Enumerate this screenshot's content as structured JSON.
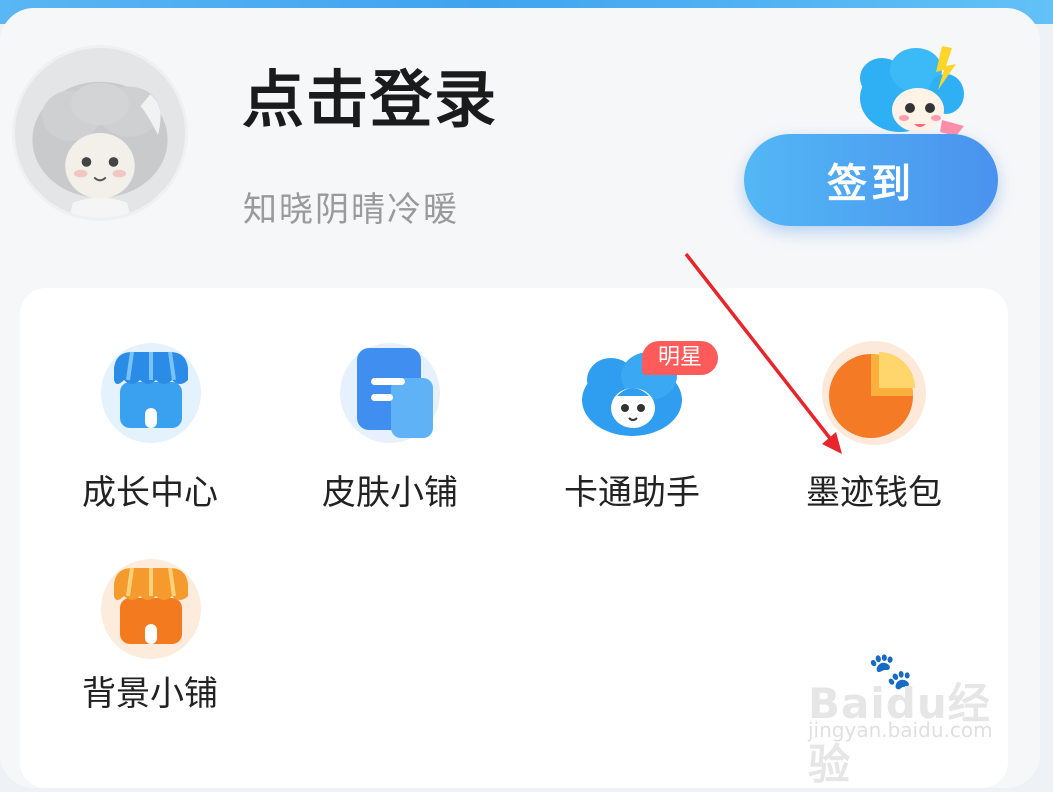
{
  "profile": {
    "login_title": "点击登录",
    "subtitle": "知晓阴晴冷暖",
    "checkin_label": "签到"
  },
  "menu": {
    "items": [
      {
        "label": "成长中心",
        "icon": "shop-icon",
        "color": "#3aa0f0"
      },
      {
        "label": "皮肤小铺",
        "icon": "document-icon",
        "color": "#3f8ef0"
      },
      {
        "label": "卡通助手",
        "icon": "cloud-mascot-icon",
        "color": "#3f9ef0",
        "badge": "明星"
      },
      {
        "label": "墨迹钱包",
        "icon": "pie-chart-icon",
        "color": "#f57a25"
      },
      {
        "label": "背景小铺",
        "icon": "shop-icon",
        "color": "#f47a20"
      }
    ]
  },
  "watermark": {
    "brand": "Baidu经验",
    "url": "jingyan.baidu.com"
  },
  "colors": {
    "accent_blue": "#4a9ff0",
    "badge_red": "#ff5b5b",
    "annotation_red": "#e8252a"
  }
}
